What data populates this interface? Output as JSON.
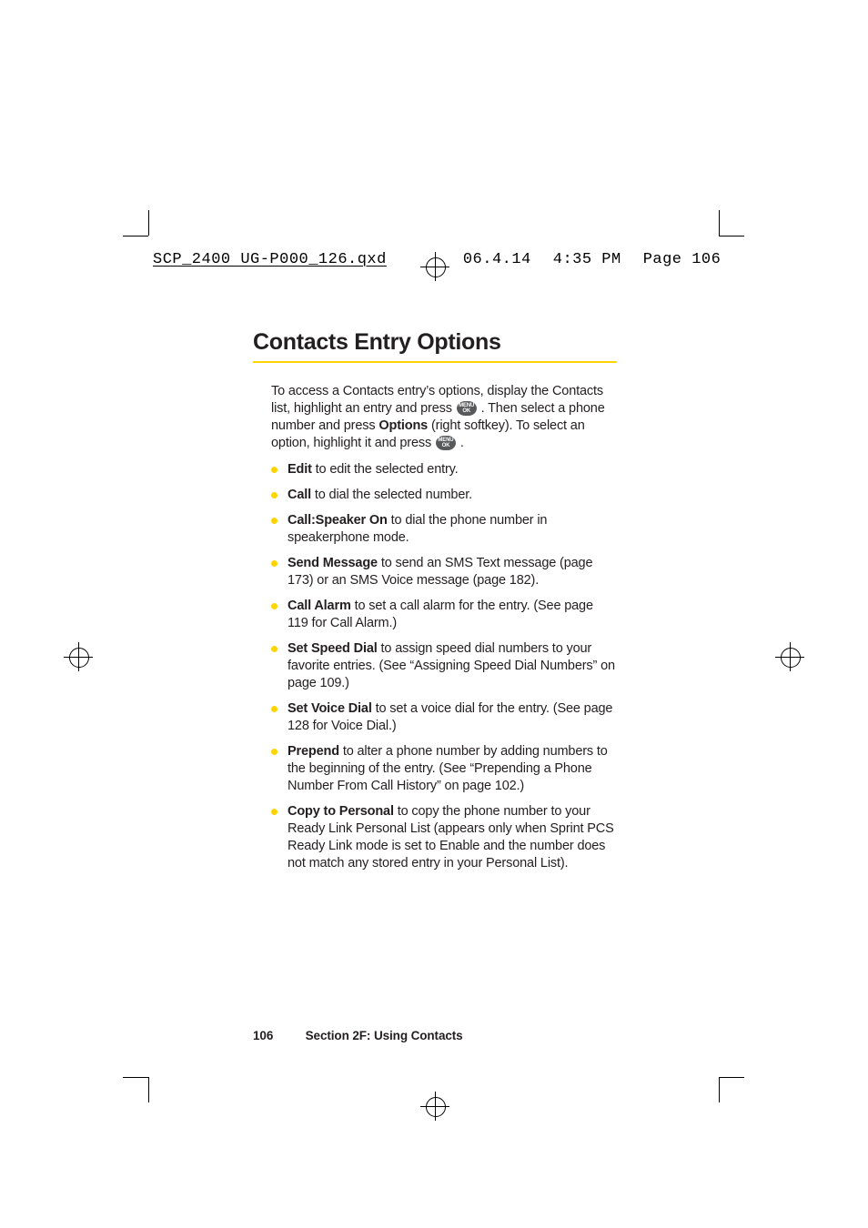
{
  "slug": {
    "filename": "SCP_2400 UG-P000_126.qxd",
    "date": "06.4.14",
    "time": "4:35 PM",
    "page_label": "Page 106"
  },
  "title": "Contacts Entry Options",
  "intro": {
    "p1a": "To access a Contacts entry’s options, display the Contacts list, highlight an entry and press ",
    "p1b": " . Then select a phone number and press ",
    "options_bold": "Options",
    "p1c": " (right softkey). To select an option, highlight it and press ",
    "p1d": " ."
  },
  "icon_top": "MENU",
  "icon_bottom": "OK",
  "items": [
    {
      "bold": "Edit",
      "rest": " to edit the selected entry."
    },
    {
      "bold": "Call",
      "rest": " to dial the selected number."
    },
    {
      "bold": "Call:Speaker On",
      "rest": " to dial the phone number in speakerphone mode."
    },
    {
      "bold": "Send Message",
      "rest": " to send an SMS Text message (page 173) or an SMS Voice message (page 182)."
    },
    {
      "bold": "Call Alarm",
      "rest": " to set a call alarm for the entry. (See page 119 for Call Alarm.)"
    },
    {
      "bold": "Set Speed Dial",
      "rest": " to assign speed dial numbers to your favorite entries. (See “Assigning Speed Dial Numbers” on page 109.)"
    },
    {
      "bold": "Set  Voice Dial",
      "rest": " to set a voice dial for the entry. (See page 128 for Voice Dial.)"
    },
    {
      "bold": "Prepend",
      "rest": " to alter a phone number by adding numbers to the beginning of the entry. (See  “Prepending a Phone Number From Call History” on page 102.)"
    },
    {
      "bold": "Copy to Personal",
      "rest": " to copy the phone number to your Ready Link Personal List (appears only when Sprint PCS Ready Link mode is set to Enable and the number does not match any stored entry in your Personal List)."
    }
  ],
  "footer": {
    "page": "106",
    "section": "Section 2F: Using Contacts"
  }
}
